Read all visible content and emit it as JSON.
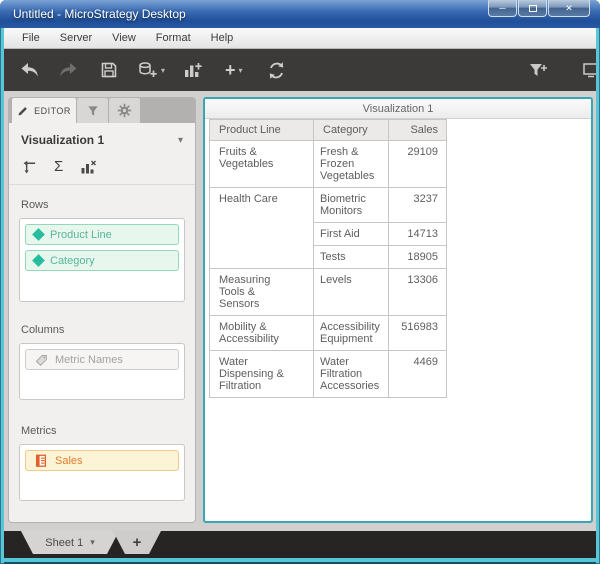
{
  "window": {
    "title": "Untitled - MicroStrategy Desktop"
  },
  "menu_bar": {
    "items": [
      {
        "label": "File"
      },
      {
        "label": "Server"
      },
      {
        "label": "View"
      },
      {
        "label": "Format"
      },
      {
        "label": "Help"
      }
    ]
  },
  "toolbar": {
    "icons": [
      "undo",
      "redo",
      "save",
      "add-data",
      "add-visualization",
      "insert",
      "refresh",
      "add-filter",
      "panel"
    ]
  },
  "editor_panel": {
    "tabs": {
      "editor": "EDITOR",
      "icon_tabs": [
        "filter",
        "settings"
      ]
    },
    "visualization_selector": {
      "value": "Visualization 1"
    },
    "tools": [
      "swap-axes",
      "totals",
      "clear-visualization"
    ],
    "sections": {
      "rows": {
        "label": "Rows",
        "chips": [
          {
            "label": "Product Line",
            "type": "attribute"
          },
          {
            "label": "Category",
            "type": "attribute"
          }
        ]
      },
      "columns": {
        "label": "Columns",
        "chips": [
          {
            "label": "Metric Names",
            "type": "placeholder"
          }
        ]
      },
      "metrics": {
        "label": "Metrics",
        "chips": [
          {
            "label": "Sales",
            "type": "metric"
          }
        ]
      }
    }
  },
  "visualization": {
    "title": "Visualization 1",
    "table": {
      "headers": [
        "Product Line",
        "Category",
        "Sales"
      ],
      "groups": [
        {
          "product_line": "Fruits & Vegetables",
          "items": [
            {
              "category": "Fresh & Frozen Vegetables",
              "sales": "29109"
            }
          ]
        },
        {
          "product_line": "Health Care",
          "items": [
            {
              "category": "Biometric Monitors",
              "sales": "3237"
            },
            {
              "category": "First Aid",
              "sales": "14713"
            },
            {
              "category": "Tests",
              "sales": "18905"
            }
          ]
        },
        {
          "product_line": "Measuring Tools & Sensors",
          "items": [
            {
              "category": "Levels",
              "sales": "13306"
            }
          ]
        },
        {
          "product_line": "Mobility & Accessibility",
          "items": [
            {
              "category": "Accessibility Equipment",
              "sales": "516983"
            }
          ]
        },
        {
          "product_line": "Water Dispensing & Filtration",
          "items": [
            {
              "category": "Water Filtration Accessories",
              "sales": "4469"
            }
          ]
        }
      ]
    }
  },
  "sheet_bar": {
    "sheet_label": "Sheet 1",
    "add_label": "+"
  },
  "colors": {
    "titlebar_blue": "#2a5aa5",
    "frame_cyan": "#57c7d8",
    "toolbar_bg": "#3b3a38",
    "viz_border_teal": "#39a6b4",
    "attribute_teal": "#27bc9d",
    "metric_orange": "#e07c2c"
  }
}
